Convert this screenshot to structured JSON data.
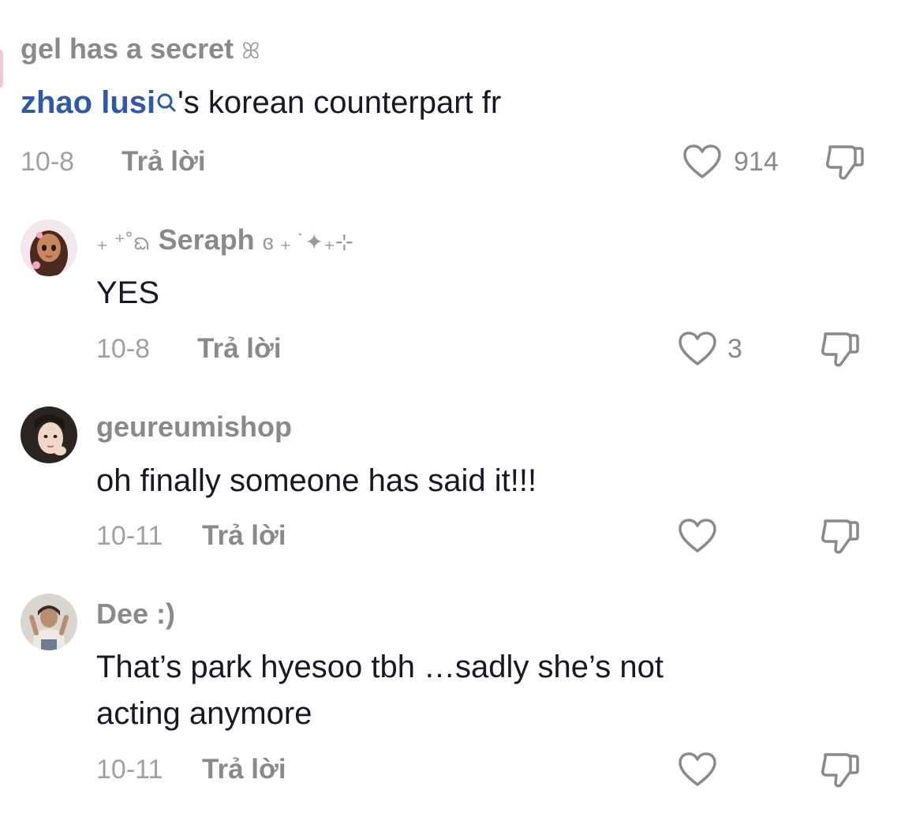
{
  "comments": [
    {
      "username": "gel has a secret",
      "username_suffix": "ꕤ",
      "mention": "zhao lusi",
      "text": "'s korean counterpart fr",
      "date": "10-8",
      "reply": "Trả lời",
      "likes": "914"
    },
    {
      "username_prefix": "₊ ⁺˚ᨳ",
      "username": "Seraph",
      "username_suffix": "ɞ ₊ ˙✦₊⊹",
      "text": "YES",
      "date": "10-8",
      "reply": "Trả lời",
      "likes": "3"
    },
    {
      "username": "geureumishop",
      "text": "oh finally someone has said it!!!",
      "date": "10-11",
      "reply": "Trả lời",
      "likes": ""
    },
    {
      "username": "Dee :)",
      "text_line1": "That’s park hyesoo tbh …sadly she’s not",
      "text_line2": "acting anymore",
      "date": "10-11",
      "reply": "Trả lời",
      "likes": ""
    }
  ],
  "icons": {
    "like": "heart-outline-icon",
    "dislike": "thumbs-down-icon",
    "mention": "search-icon"
  },
  "colors": {
    "mention": "#2f5aa8",
    "muted": "#8a8a8a",
    "text": "#161823"
  }
}
